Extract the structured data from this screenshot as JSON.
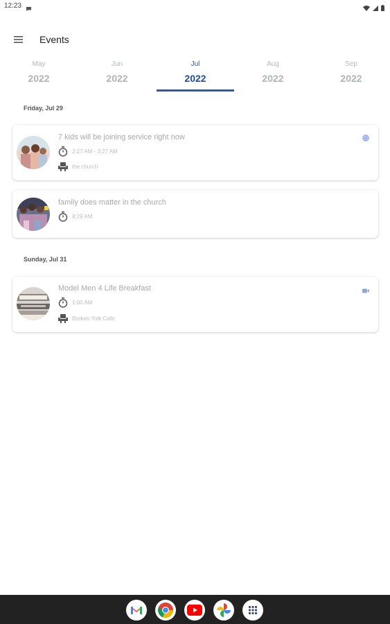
{
  "status_bar": {
    "time": "12:23"
  },
  "app_bar": {
    "title": "Events"
  },
  "tabs": [
    {
      "month": "May",
      "year": "2022",
      "active": false
    },
    {
      "month": "Jun",
      "year": "2022",
      "active": false
    },
    {
      "month": "Jul",
      "year": "2022",
      "active": true
    },
    {
      "month": "Aug",
      "year": "2022",
      "active": false
    },
    {
      "month": "Sep",
      "year": "2022",
      "active": false
    }
  ],
  "days": [
    {
      "header": "Friday, Jul 29",
      "events": [
        {
          "title": "7 kids will be joining service right now",
          "time": "2:27 AM - 3:27 AM",
          "location": "the church",
          "badge": "globe-icon"
        },
        {
          "title": "family does matter in the church",
          "time": "8:29 AM"
        }
      ]
    },
    {
      "header": "Sunday, Jul 31",
      "events": [
        {
          "title": "Model Men 4 Life Breakfast",
          "time": "1:00 AM",
          "location": "Broken Yolk Cafe",
          "badge": "video-icon"
        }
      ]
    }
  ],
  "dock": [
    "gmail-icon",
    "chrome-icon",
    "youtube-icon",
    "photos-icon",
    "app-drawer-icon"
  ],
  "colors": {
    "accent": "#2b58b4",
    "muted_text": "#a9a9a9",
    "nav_bar": "#222222"
  }
}
